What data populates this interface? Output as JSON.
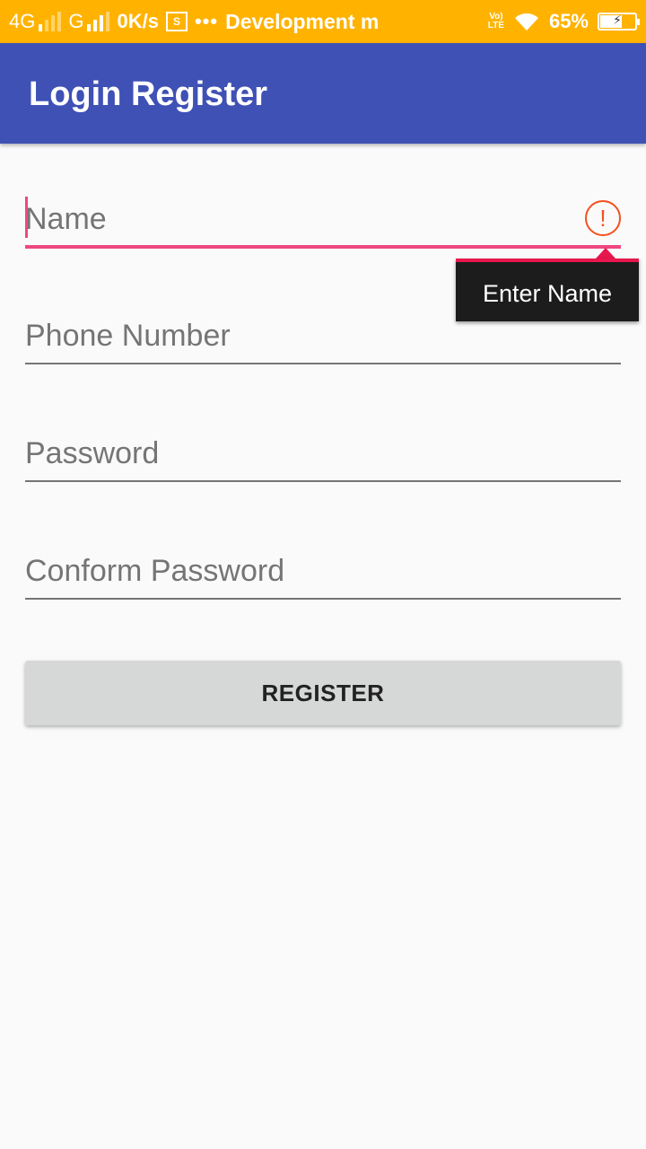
{
  "status_bar": {
    "network1": "4G",
    "network2": "G",
    "speed": "0K/s",
    "box_icon_letter": "S",
    "dots": "•••",
    "notification": "Development m",
    "volte_top": "Vo)",
    "volte_bottom": "LTE",
    "battery_percent": "65%",
    "battery_level": 0.65
  },
  "appbar": {
    "title": "Login Register"
  },
  "form": {
    "name": {
      "placeholder": "Name",
      "value": ""
    },
    "phone": {
      "placeholder": "Phone Number",
      "value": ""
    },
    "password": {
      "placeholder": "Password",
      "value": ""
    },
    "confirm_password": {
      "placeholder": "Conform Password",
      "value": ""
    },
    "error_icon": "!",
    "error_tooltip": "Enter Name",
    "register_label": "REGISTER"
  },
  "colors": {
    "status_bar": "#ffb300",
    "app_bar": "#3f51b5",
    "accent": "#ef4781",
    "error": "#f4511e",
    "button": "#d6d7d7"
  }
}
